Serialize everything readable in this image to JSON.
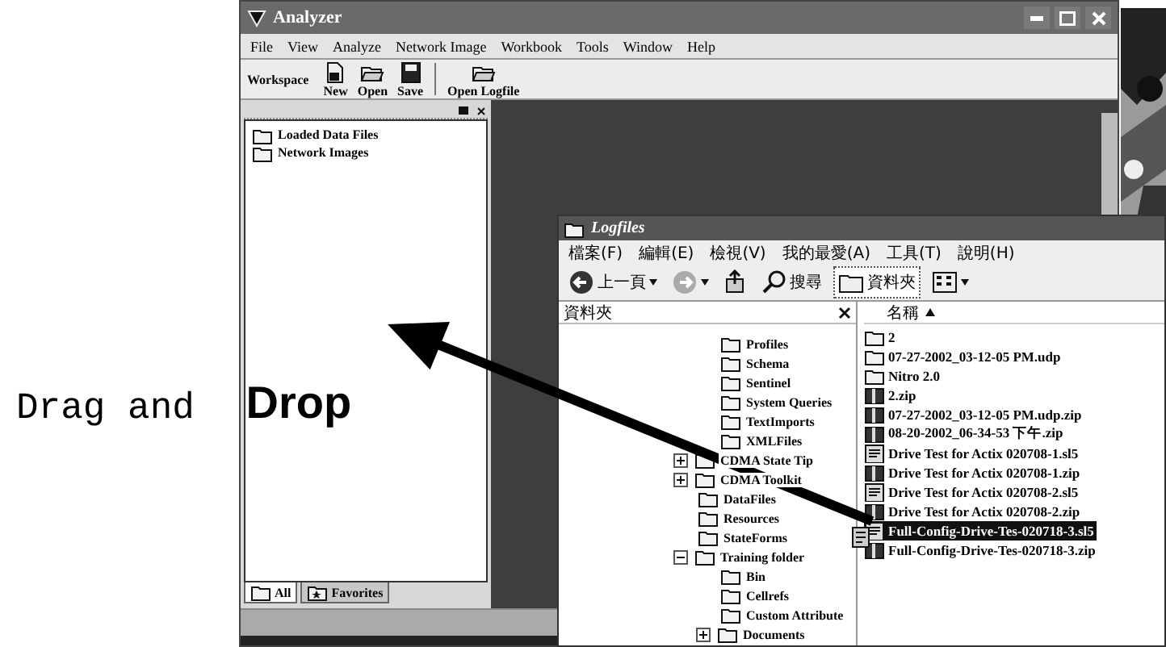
{
  "app_window": {
    "title": "Analyzer",
    "menu": [
      "File",
      "View",
      "Analyze",
      "Network Image",
      "Workbook",
      "Tools",
      "Window",
      "Help"
    ],
    "toolbar_label": "Workspace",
    "toolbar_groups": [
      [
        {
          "label": "New",
          "kind": "new"
        },
        {
          "label": "Open",
          "kind": "open"
        },
        {
          "label": "Save",
          "kind": "save"
        }
      ],
      [
        {
          "label": "Open Logfile",
          "kind": "open"
        }
      ]
    ],
    "tree": [
      {
        "label": "Loaded Data Files"
      },
      {
        "label": "Network Images"
      }
    ],
    "panel_tabs": [
      {
        "label": "All",
        "selected": true
      },
      {
        "label": "Favorites",
        "selected": false
      }
    ]
  },
  "explorer_window": {
    "title": "Logfiles",
    "menu": [
      "檔案(F)",
      "編輯(E)",
      "檢視(V)",
      "我的最愛(A)",
      "工具(T)",
      "說明(H)"
    ],
    "toolbar": [
      {
        "kind": "back",
        "label": "上一頁"
      },
      {
        "kind": "forward"
      },
      {
        "kind": "up"
      },
      {
        "kind": "search",
        "label": "搜尋"
      },
      {
        "kind": "folders",
        "label": "資料夾",
        "selected": true
      },
      {
        "kind": "views"
      }
    ],
    "folder_pane_title": "資料夾",
    "name_column": "名稱",
    "folder_tree": {
      "continued_children": [
        {
          "label": "Profiles"
        },
        {
          "label": "Schema"
        },
        {
          "label": "Sentinel"
        },
        {
          "label": "System Queries"
        },
        {
          "label": "TextImports"
        },
        {
          "label": "XMLFiles"
        }
      ],
      "items": [
        {
          "label": "CDMA State Tip",
          "kind": "collapsed"
        },
        {
          "label": "CDMA Toolkit",
          "kind": "collapsed"
        },
        {
          "label": "DataFiles",
          "kind": "leaf"
        },
        {
          "label": "Resources",
          "kind": "leaf"
        },
        {
          "label": "StateForms",
          "kind": "leaf"
        },
        {
          "label": "Training folder",
          "kind": "expanded",
          "children": [
            {
              "label": "Bin",
              "kind": "leaf"
            },
            {
              "label": "Cellrefs",
              "kind": "leaf"
            },
            {
              "label": "Custom Attribute",
              "kind": "leaf"
            },
            {
              "label": "Documents",
              "kind": "collapsed"
            }
          ]
        }
      ]
    },
    "files": [
      {
        "name": "2",
        "kind": "folder",
        "selected": false
      },
      {
        "name": "07-27-2002_03-12-05 PM.udp",
        "kind": "folder",
        "selected": false
      },
      {
        "name": "Nitro 2.0",
        "kind": "folder",
        "selected": false
      },
      {
        "name": "2.zip",
        "kind": "zip",
        "selected": false
      },
      {
        "name": "07-27-2002_03-12-05 PM.udp.zip",
        "kind": "zip",
        "selected": false
      },
      {
        "name": "08-20-2002_06-34-53 下午.zip",
        "kind": "zip",
        "selected": false
      },
      {
        "name": "Drive Test for Actix 020708-1.sl5",
        "kind": "log",
        "selected": false
      },
      {
        "name": "Drive Test for Actix 020708-1.zip",
        "kind": "zip",
        "selected": false
      },
      {
        "name": "Drive Test for Actix 020708-2.sl5",
        "kind": "log",
        "selected": false
      },
      {
        "name": "Drive Test for Actix 020708-2.zip",
        "kind": "zip",
        "selected": false
      },
      {
        "name": "Full-Config-Drive-Tes-020718-3.sl5",
        "kind": "log",
        "selected": true
      },
      {
        "name": "Full-Config-Drive-Tes-020718-3.zip",
        "kind": "zip",
        "selected": false
      }
    ]
  },
  "annotation": {
    "caption": "Drag and **Drop**"
  }
}
